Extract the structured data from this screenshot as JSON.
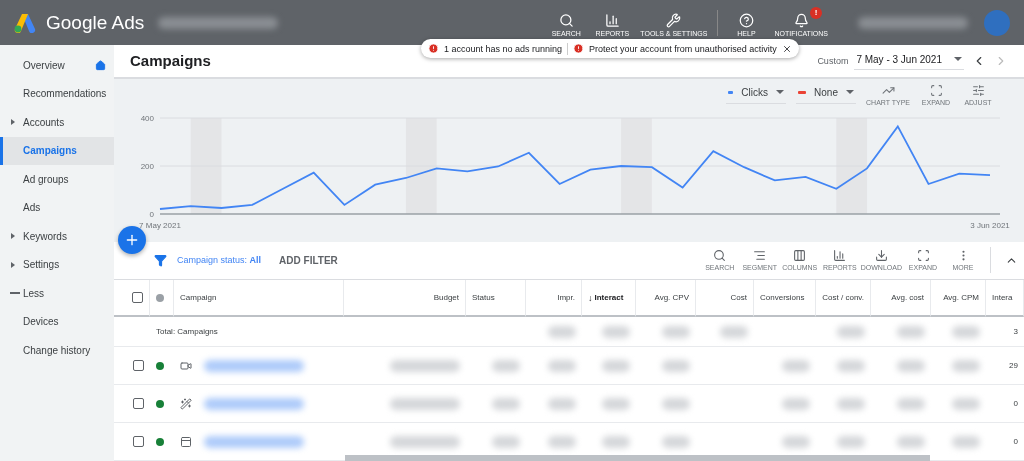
{
  "topbar": {
    "product": "Google Ads",
    "actions": [
      {
        "kind": "search",
        "label": "SEARCH"
      },
      {
        "kind": "reports",
        "label": "REPORTS"
      },
      {
        "kind": "tools",
        "label": "TOOLS & SETTINGS"
      },
      {
        "kind": "help",
        "label": "HELP"
      },
      {
        "kind": "notifications",
        "label": "NOTIFICATIONS",
        "badge": "!"
      }
    ]
  },
  "alerts": [
    "1 account has no ads running",
    "Protect your account from unauthorised activity"
  ],
  "sidebar": {
    "items": [
      {
        "label": "Overview",
        "kind": "home",
        "selected": false
      },
      {
        "label": "Recommendations",
        "kind": "plain",
        "selected": false
      },
      {
        "label": "Accounts",
        "kind": "expand",
        "selected": false
      },
      {
        "label": "Campaigns",
        "kind": "plain",
        "selected": true
      },
      {
        "label": "Ad groups",
        "kind": "plain",
        "selected": false
      },
      {
        "label": "Ads",
        "kind": "plain",
        "selected": false
      },
      {
        "label": "Keywords",
        "kind": "expand",
        "selected": false
      },
      {
        "label": "Settings",
        "kind": "expand",
        "selected": false
      },
      {
        "label": "Less",
        "kind": "less",
        "selected": false
      },
      {
        "label": "Devices",
        "kind": "plain",
        "selected": false
      },
      {
        "label": "Change history",
        "kind": "plain",
        "selected": false
      }
    ]
  },
  "page": {
    "title": "Campaigns",
    "range_label": "Custom",
    "range": "7 May - 3 Jun 2021"
  },
  "chart": {
    "second_metric": {
      "label": "None",
      "color": "#ea4335"
    },
    "tools": [
      {
        "kind": "chart",
        "label": "CHART TYPE"
      },
      {
        "kind": "expand",
        "label": "EXPAND"
      },
      {
        "kind": "adjust",
        "label": "ADJUST"
      }
    ],
    "chart_data": {
      "type": "line",
      "categories": [
        "7 May 2021",
        null,
        null,
        null,
        null,
        null,
        null,
        null,
        null,
        null,
        null,
        null,
        null,
        null,
        null,
        null,
        null,
        null,
        null,
        null,
        null,
        null,
        null,
        null,
        null,
        null,
        null,
        "3 Jun 2021"
      ],
      "series": [
        {
          "name": "Clicks",
          "color": "#4285f4",
          "values": [
            21,
            33,
            25,
            38,
            105,
            172,
            38,
            122,
            150,
            190,
            178,
            198,
            255,
            125,
            185,
            200,
            195,
            110,
            262,
            195,
            140,
            155,
            105,
            190,
            365,
            125,
            168,
            162
          ]
        }
      ],
      "ylim": [
        0,
        400
      ],
      "yticks": [
        0,
        200,
        400
      ]
    }
  },
  "filter": {
    "label": "Campaign status:",
    "value": "All",
    "add": "ADD FILTER",
    "tools": [
      {
        "kind": "search",
        "label": "SEARCH"
      },
      {
        "kind": "segment",
        "label": "SEGMENT"
      },
      {
        "kind": "columns",
        "label": "COLUMNS"
      },
      {
        "kind": "reports",
        "label": "REPORTS"
      },
      {
        "kind": "download",
        "label": "DOWNLOAD"
      },
      {
        "kind": "expand",
        "label": "EXPAND"
      },
      {
        "kind": "more",
        "label": "MORE"
      }
    ]
  },
  "table": {
    "select_all_checked": false,
    "columns": [
      {
        "label": "Campaign",
        "kind": "text",
        "sorted": false
      },
      {
        "label": "Budget",
        "kind": "number",
        "sorted": false
      },
      {
        "label": "Status",
        "kind": "text",
        "sorted": false
      },
      {
        "label": "Impr.",
        "kind": "number",
        "sorted": false
      },
      {
        "label": "Interact",
        "kind": "text",
        "sorted": true,
        "sort_arrow": "↓"
      },
      {
        "label": "Avg. CPV",
        "kind": "number",
        "sorted": false
      },
      {
        "label": "Cost",
        "kind": "number",
        "sorted": false
      },
      {
        "label": "Conversions",
        "kind": "text",
        "sorted": false
      },
      {
        "label": "Cost / conv.",
        "kind": "number",
        "sorted": false
      },
      {
        "label": "Avg. cost",
        "kind": "number",
        "sorted": false
      },
      {
        "label": "Avg. CPM",
        "kind": "number",
        "sorted": false
      },
      {
        "label": "Intera",
        "kind": "text",
        "sorted": false
      }
    ],
    "total": {
      "label": "Total: Campaigns",
      "last": "3"
    },
    "rows": [
      {
        "kind": "video",
        "checked": false,
        "last": "29"
      },
      {
        "kind": "wand",
        "checked": false,
        "last": "0"
      },
      {
        "kind": "display",
        "checked": false,
        "last": "0"
      }
    ]
  }
}
